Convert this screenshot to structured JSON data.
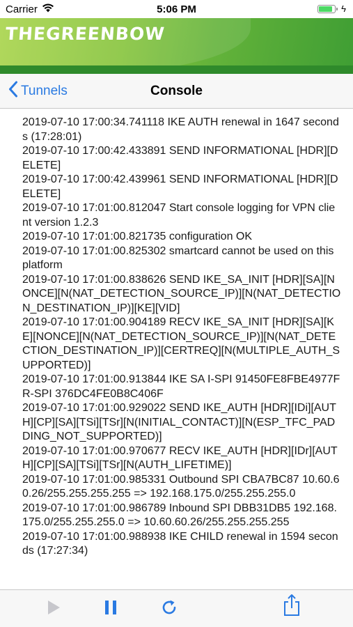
{
  "status_bar": {
    "carrier": "Carrier",
    "time": "5:06 PM"
  },
  "banner": {
    "logo_text": "THEGREENBOW"
  },
  "nav": {
    "back_label": "Tunnels",
    "title": "Console"
  },
  "console": {
    "lines": [
      "2019-07-10 17:00:34.741118    IKE AUTH renewal in 1647 seconds (17:28:01)",
      "2019-07-10 17:00:42.433891    SEND INFORMATIONAL [HDR][DELETE]",
      "2019-07-10 17:00:42.439961    SEND INFORMATIONAL [HDR][DELETE]",
      "2019-07-10 17:01:00.812047    Start console logging for VPN client version 1.2.3",
      "2019-07-10 17:01:00.821735    configuration OK",
      "2019-07-10 17:01:00.825302    smartcard cannot be used on this platform",
      "2019-07-10 17:01:00.838626    SEND IKE_SA_INIT [HDR][SA][NONCE][N(NAT_DETECTION_SOURCE_IP)][N(NAT_DETECTION_DESTINATION_IP)][KE][VID]",
      "2019-07-10 17:01:00.904189    RECV IKE_SA_INIT [HDR][SA][KE][NONCE][N(NAT_DETECTION_SOURCE_IP)][N(NAT_DETECTION_DESTINATION_IP)][CERTREQ][N(MULTIPLE_AUTH_SUPPORTED)]",
      "2019-07-10 17:01:00.913844    IKE SA I-SPI 91450FE8FBE4977F R-SPI 376DC4FE0B8C406F",
      "2019-07-10 17:01:00.929022    SEND IKE_AUTH [HDR][IDi][AUTH][CP][SA][TSi][TSr][N(INITIAL_CONTACT)][N(ESP_TFC_PADDING_NOT_SUPPORTED)]",
      "2019-07-10 17:01:00.970677    RECV IKE_AUTH [HDR][IDr][AUTH][CP][SA][TSi][TSr][N(AUTH_LIFETIME)]",
      "2019-07-10 17:01:00.985331    Outbound SPI CBA7BC87 10.60.60.26/255.255.255.255 => 192.168.175.0/255.255.255.0",
      "2019-07-10 17:01:00.986789    Inbound  SPI DBB31DB5 192.168.175.0/255.255.255.0 => 10.60.60.26/255.255.255.255",
      "2019-07-10 17:01:00.988938    IKE CHILD renewal in 1594 seconds (17:27:34)"
    ]
  },
  "toolbar": {
    "play_icon": "play-icon",
    "pause_icon": "pause-icon",
    "refresh_icon": "refresh-icon",
    "share_icon": "share-icon"
  },
  "colors": {
    "accent": "#2a7ae2",
    "banner_green": "#64b33a"
  }
}
